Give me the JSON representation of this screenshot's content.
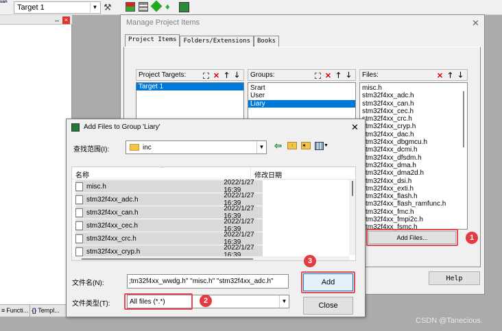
{
  "toolbar": {
    "target_label": "Target 1",
    "corner_text": "uan"
  },
  "left_panel": {
    "pin_glyph": "↔",
    "tabs": [
      "Functi...",
      "Templ..."
    ],
    "tab_prefixes": [
      "≡",
      "{}"
    ]
  },
  "manage_dialog": {
    "title": "Manage Project Items",
    "tabs": [
      "Project Items",
      "Folders/Extensions",
      "Books"
    ],
    "project_targets": {
      "label": "Project Targets:",
      "items": [
        "Target 1"
      ]
    },
    "groups": {
      "label": "Groups:",
      "items": [
        "Srart",
        "User",
        "Liary"
      ]
    },
    "files": {
      "label": "Files:",
      "items": [
        "misc.h",
        "stm32f4xx_adc.h",
        "stm32f4xx_can.h",
        "stm32f4xx_cec.h",
        "stm32f4xx_crc.h",
        "stm32f4xx_cryp.h",
        "stm32f4xx_dac.h",
        "stm32f4xx_dbgmcu.h",
        "stm32f4xx_dcmi.h",
        "stm32f4xx_dfsdm.h",
        "stm32f4xx_dma.h",
        "stm32f4xx_dma2d.h",
        "stm32f4xx_dsi.h",
        "stm32f4xx_exti.h",
        "stm32f4xx_flash.h",
        "stm32f4xx_flash_ramfunc.h",
        "stm32f4xx_fmc.h",
        "stm32f4xx_fmpi2c.h",
        "stm32f4xx_fsmc.h"
      ]
    },
    "add_files_button": "Add Files...",
    "help_button": "Help",
    "close_glyph": "✕"
  },
  "add_dialog": {
    "title": "Add Files to Group 'Liary'",
    "look_in_label": "查找范围(I):",
    "look_in_value": "inc",
    "columns": {
      "name": "名称",
      "date": "修改日期"
    },
    "rows": [
      {
        "name": "misc.h",
        "date": "2022/1/27 16:39"
      },
      {
        "name": "stm32f4xx_adc.h",
        "date": "2022/1/27 16:39"
      },
      {
        "name": "stm32f4xx_can.h",
        "date": "2022/1/27 16:39"
      },
      {
        "name": "stm32f4xx_cec.h",
        "date": "2022/1/27 16:39"
      },
      {
        "name": "stm32f4xx_crc.h",
        "date": "2022/1/27 16:39"
      },
      {
        "name": "stm32f4xx_cryp.h",
        "date": "2022/1/27 16:39"
      }
    ],
    "filename_label": "文件名(N):",
    "filename_value": ";tm32f4xx_wwdg.h\" \"misc.h\" \"stm32f4xx_adc.h\"",
    "filetype_label": "文件类型(T):",
    "filetype_value": "All files (*.*)",
    "add_button": "Add",
    "close_button": "Close",
    "close_glyph": "✕"
  },
  "badges": [
    "1",
    "2",
    "3"
  ],
  "watermark": "CSDN @Tanecious.",
  "colors": {
    "selection": "#0078d7",
    "annotation": "#e04a50"
  }
}
